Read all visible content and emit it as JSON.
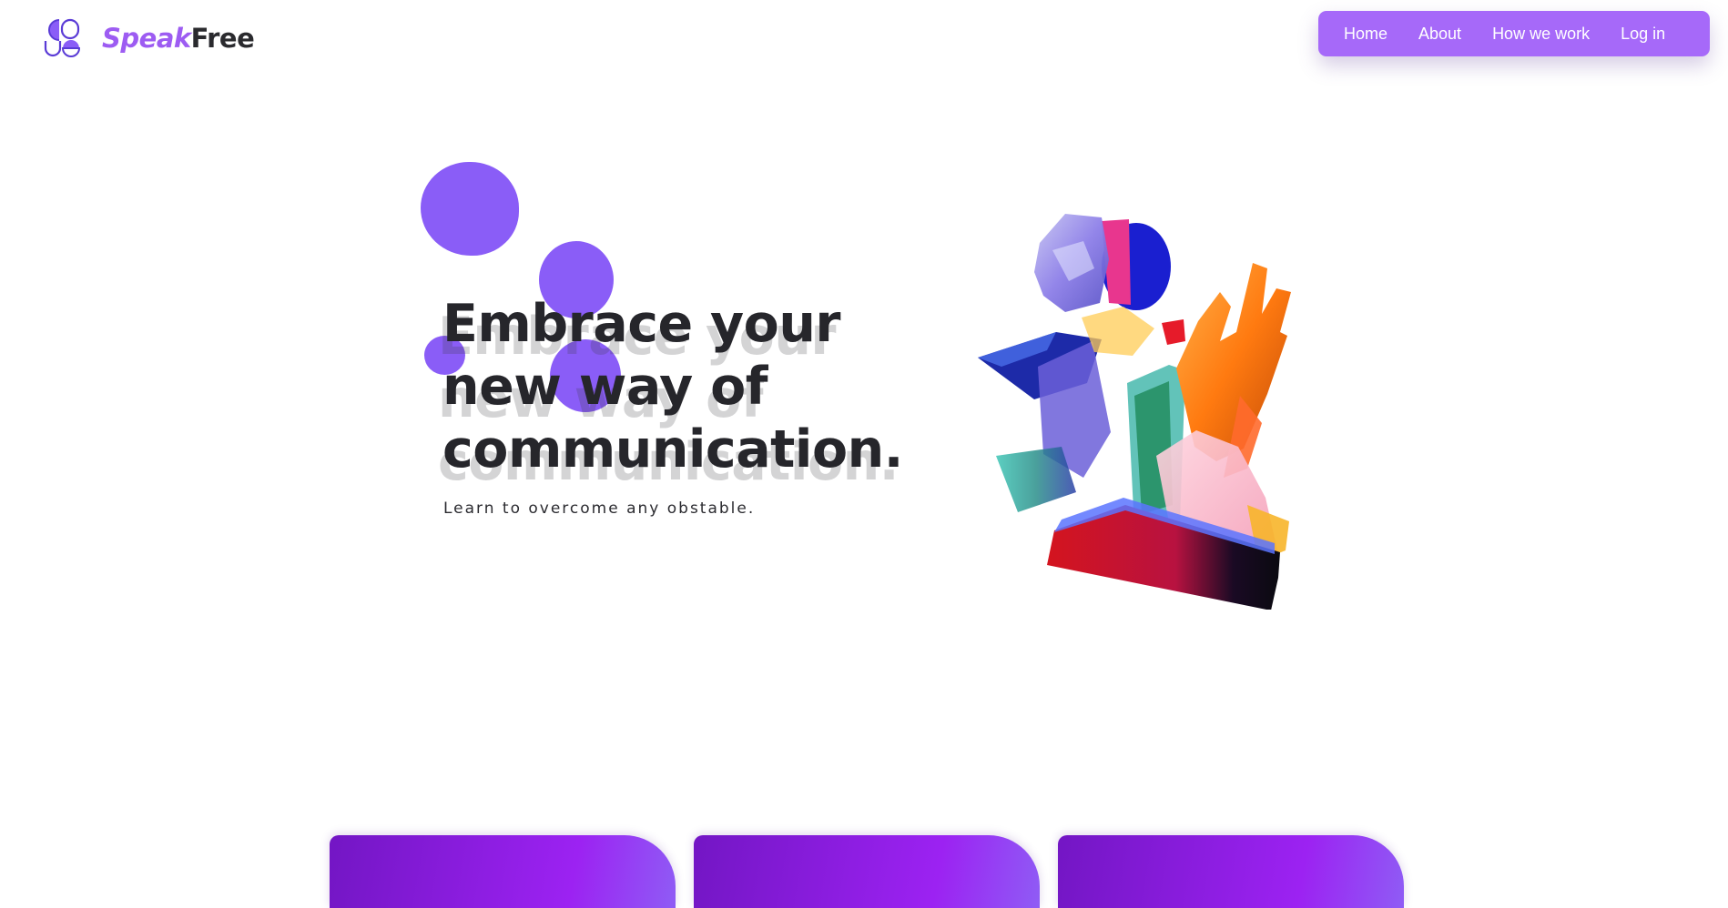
{
  "brand": {
    "name_part1": "Speak",
    "name_part2": "Free",
    "icon": "speakfree-logo-icon",
    "accent_color": "#9d5cf2"
  },
  "nav": {
    "background_color": "#a669f9",
    "items": [
      {
        "label": "Home"
      },
      {
        "label": "About"
      },
      {
        "label": "How we work"
      },
      {
        "label": "Log in"
      }
    ]
  },
  "hero": {
    "headline_lines": [
      "Embrace your",
      "new way of",
      "communication."
    ],
    "subtitle": "Learn to overcome any obstable.",
    "blob_color": "#8a5df7",
    "illustration": "abstract-3d-head-and-hand-illustration"
  },
  "cards": {
    "count_visible": 3,
    "gradient_colors": [
      "#7316c4",
      "#9c22f2",
      "#8f5cf5"
    ]
  }
}
